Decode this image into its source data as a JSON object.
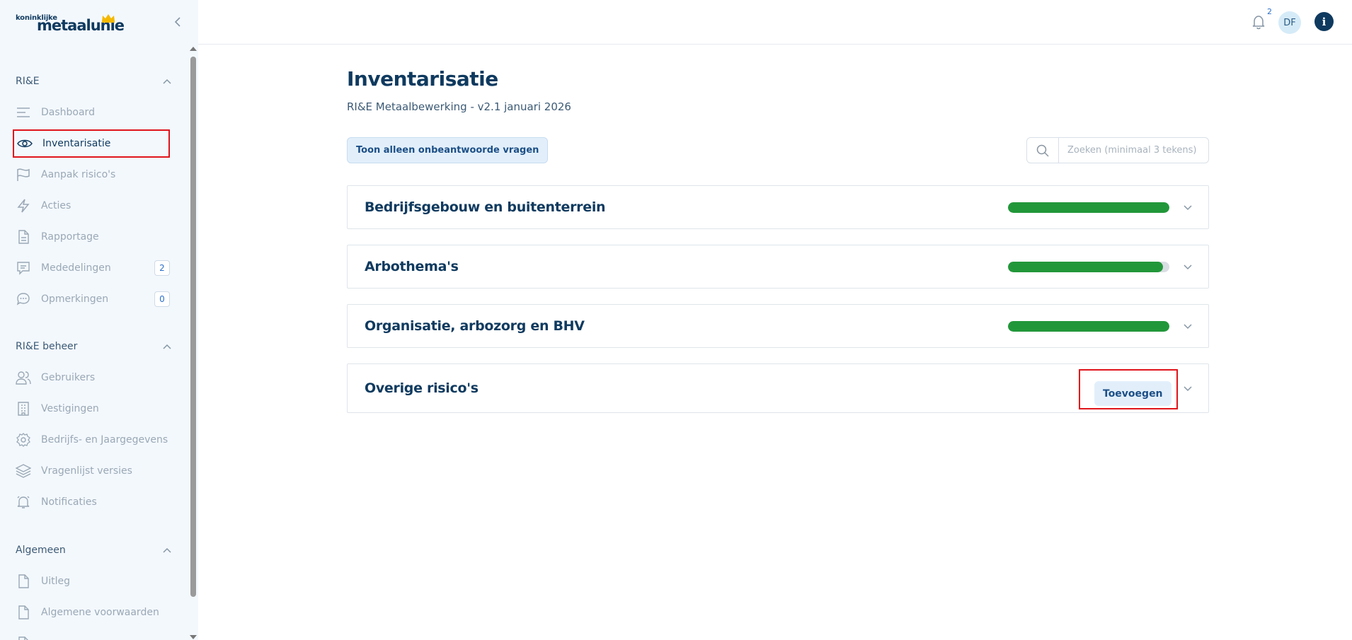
{
  "brand": {
    "small": "koninklijke",
    "big": "metaalunie"
  },
  "sidebar": {
    "sections": [
      {
        "title": "RI&E",
        "items": [
          {
            "label": "Dashboard",
            "icon": "dashboard-icon"
          },
          {
            "label": "Inventarisatie",
            "icon": "eye-icon",
            "active": true
          },
          {
            "label": "Aanpak risico's",
            "icon": "flag-icon"
          },
          {
            "label": "Acties",
            "icon": "lightning-icon"
          },
          {
            "label": "Rapportage",
            "icon": "document-icon"
          },
          {
            "label": "Mededelingen",
            "icon": "message-icon",
            "badge": "2"
          },
          {
            "label": "Opmerkingen",
            "icon": "comment-icon",
            "badge": "0"
          }
        ]
      },
      {
        "title": "RI&E beheer",
        "items": [
          {
            "label": "Gebruikers",
            "icon": "users-icon"
          },
          {
            "label": "Vestigingen",
            "icon": "building-icon"
          },
          {
            "label": "Bedrijfs- en Jaargegevens",
            "icon": "gear-icon"
          },
          {
            "label": "Vragenlijst versies",
            "icon": "layers-icon"
          },
          {
            "label": "Notificaties",
            "icon": "bell-icon"
          }
        ]
      },
      {
        "title": "Algemeen",
        "items": [
          {
            "label": "Uitleg",
            "icon": "file-icon"
          },
          {
            "label": "Algemene voorwaarden",
            "icon": "file-icon"
          }
        ]
      }
    ]
  },
  "topbar": {
    "notification_count": "2",
    "avatar_initials": "DF",
    "info_label": "i"
  },
  "main": {
    "title": "Inventarisatie",
    "subtitle": "RI&E Metaalbewerking - v2.1 januari 2026",
    "filter_button": "Toon alleen onbeantwoorde vragen",
    "search_placeholder": "Zoeken (minimaal 3 tekens)",
    "categories": [
      {
        "title": "Bedrijfsgebouw en buitenterrein",
        "progress": 1.0
      },
      {
        "title": "Arbothema's",
        "progress": 0.96
      },
      {
        "title": "Organisatie, arbozorg en BHV",
        "progress": 1.0
      },
      {
        "title": "Overige risico's",
        "action": "Toevoegen"
      }
    ]
  },
  "colors": {
    "primary": "#0f3a5f",
    "progress_green": "#22973a",
    "highlight_red": "#e0141b",
    "sidebar_bg": "#f3f8fd",
    "button_bg": "#e2effb"
  }
}
